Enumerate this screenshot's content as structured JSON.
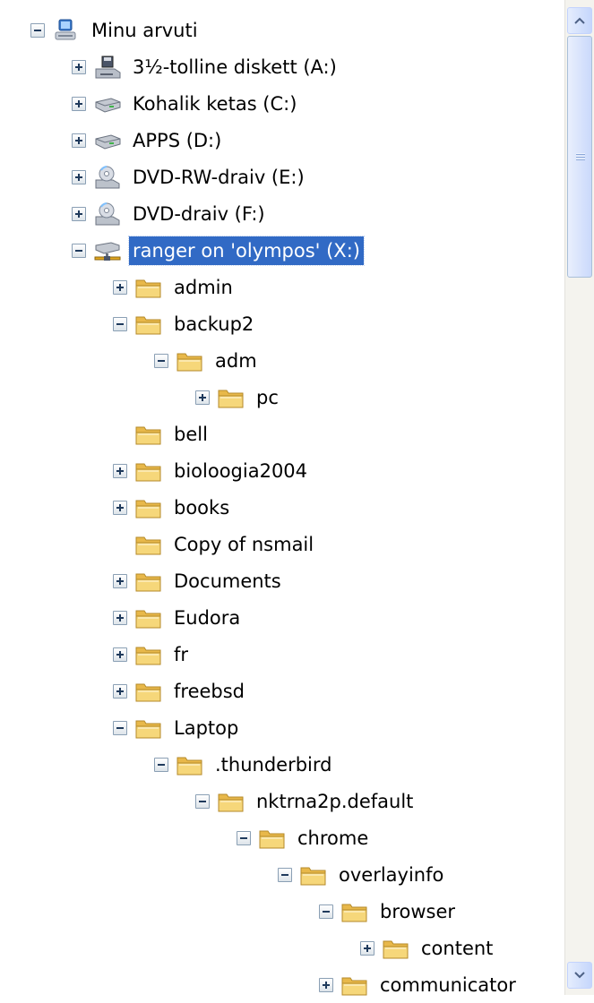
{
  "tree": {
    "root": {
      "label": "Minu arvuti",
      "icon": "my-computer-icon",
      "state": "expanded"
    },
    "drives": [
      {
        "label": "3½-tolline diskett (A:)",
        "icon": "floppy-drive-icon",
        "state": "collapsed"
      },
      {
        "label": "Kohalik ketas (C:)",
        "icon": "hard-disk-icon",
        "state": "collapsed"
      },
      {
        "label": "APPS (D:)",
        "icon": "hard-disk-icon",
        "state": "collapsed"
      },
      {
        "label": "DVD-RW-draiv (E:)",
        "icon": "dvd-drive-icon",
        "state": "collapsed"
      },
      {
        "label": "DVD-draiv (F:)",
        "icon": "dvd-drive-icon",
        "state": "collapsed"
      },
      {
        "label": "ranger on 'olympos' (X:)",
        "icon": "network-drive-icon",
        "state": "expanded",
        "selected": true
      }
    ],
    "folders": [
      {
        "label": "admin",
        "level": 2,
        "state": "collapsed"
      },
      {
        "label": "backup2",
        "level": 2,
        "state": "expanded"
      },
      {
        "label": "adm",
        "level": 3,
        "state": "expanded"
      },
      {
        "label": "pc",
        "level": 4,
        "state": "collapsed"
      },
      {
        "label": "bell",
        "level": 2,
        "state": "none"
      },
      {
        "label": "bioloogia2004",
        "level": 2,
        "state": "collapsed"
      },
      {
        "label": "books",
        "level": 2,
        "state": "collapsed"
      },
      {
        "label": "Copy of nsmail",
        "level": 2,
        "state": "none"
      },
      {
        "label": "Documents",
        "level": 2,
        "state": "collapsed"
      },
      {
        "label": "Eudora",
        "level": 2,
        "state": "collapsed"
      },
      {
        "label": "fr",
        "level": 2,
        "state": "collapsed"
      },
      {
        "label": "freebsd",
        "level": 2,
        "state": "collapsed"
      },
      {
        "label": "Laptop",
        "level": 2,
        "state": "expanded"
      },
      {
        "label": ".thunderbird",
        "level": 3,
        "state": "expanded"
      },
      {
        "label": "nktrna2p.default",
        "level": 4,
        "state": "expanded"
      },
      {
        "label": "chrome",
        "level": 5,
        "state": "expanded"
      },
      {
        "label": "overlayinfo",
        "level": 6,
        "state": "expanded"
      },
      {
        "label": "browser",
        "level": 7,
        "state": "expanded"
      },
      {
        "label": "content",
        "level": 8,
        "state": "collapsed"
      },
      {
        "label": "communicator",
        "level": 7,
        "state": "collapsed"
      }
    ]
  },
  "scrollbar": {
    "up_arrow": "▲",
    "down_arrow": "▼",
    "position": 0.0
  },
  "colors": {
    "selection": "#316ac5",
    "folder": "#f1c95a"
  }
}
